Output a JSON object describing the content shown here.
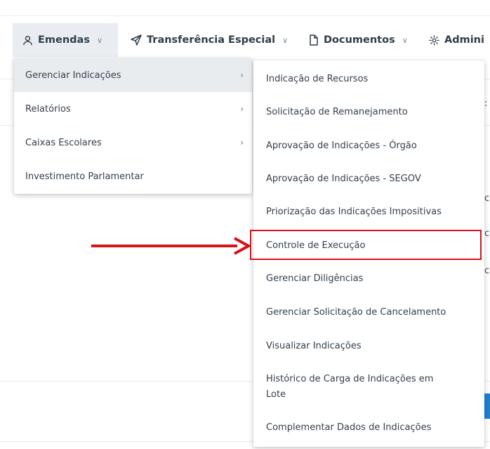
{
  "navbar": {
    "items": [
      {
        "label": "Emendas",
        "icon": "user-icon",
        "active": true
      },
      {
        "label": "Transferência Especial",
        "icon": "send-icon"
      },
      {
        "label": "Documentos",
        "icon": "document-icon"
      },
      {
        "label": "Admini",
        "icon": "gear-icon"
      }
    ],
    "chevron": "∨"
  },
  "menu": {
    "items": [
      {
        "label": "Gerenciar Indicações",
        "has_submenu": true,
        "highlighted": true
      },
      {
        "label": "Relatórios",
        "has_submenu": true
      },
      {
        "label": "Caixas Escolares",
        "has_submenu": true
      },
      {
        "label": "Investimento Parlamentar",
        "has_submenu": false
      }
    ],
    "arrow": "›"
  },
  "submenu": {
    "items": [
      {
        "label": "Indicação de Recursos"
      },
      {
        "label": "Solicitação de Remanejamento"
      },
      {
        "label": "Aprovação de Indicações - Órgão"
      },
      {
        "label": "Aprovação de Indicações - SEGOV"
      },
      {
        "label": "Priorização das Indicações Impositivas"
      },
      {
        "label": "Controle de Execução",
        "annotated": true
      },
      {
        "label": "Gerenciar Diligências"
      },
      {
        "label": "Gerenciar Solicitação de Cancelamento"
      },
      {
        "label": "Visualizar Indicações"
      },
      {
        "label": "Histórico de Carga de Indicações em Lote"
      },
      {
        "label": "Complementar Dados de Indicações"
      }
    ]
  },
  "annotation": {
    "color": "#d7121a"
  }
}
